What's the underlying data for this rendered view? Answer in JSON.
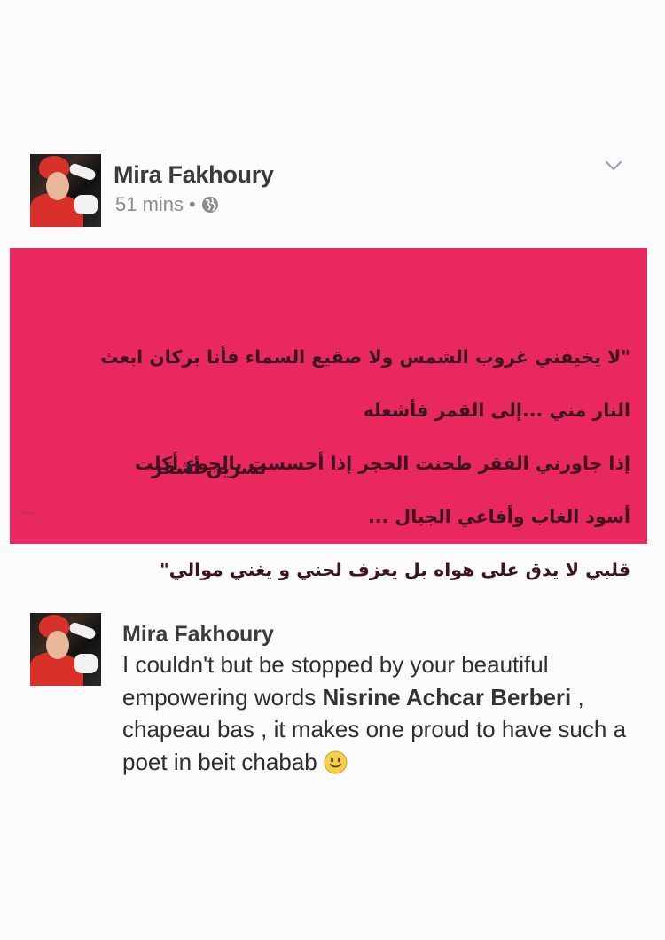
{
  "post": {
    "author": "Mira Fakhoury",
    "time": "51 mins",
    "separator": "•",
    "privacy_icon": "globe-icon",
    "menu_icon": "chevron-down-icon"
  },
  "quote_card": {
    "background": "#e8285e",
    "text_color": "#3a1420",
    "lines": [
      "\"لا يخيفني غروب الشمس ولا صقيع السماء فأنا بركان ابعث",
      "النار مني ...إلى القمر فأشعله",
      "إذا جاورني الفقر طحنت الحجر إذا أحسست بالجوع أكلت",
      "أسود الغاب وأفاعي الجبال ...",
      "قلبي لا يدق على هواه بل يعزف لحني و يغني موالي\""
    ],
    "signature": "نسرين أشقر"
  },
  "comment": {
    "author": "Mira Fakhoury",
    "text_part1": "I couldn't but be stopped by your beautiful empowering words ",
    "mention": "Nisrine Achcar Berberi",
    "text_part2": " , chapeau bas , it makes one proud to have such a poet in beit chabab ",
    "emoji_icon": "smiley-icon"
  }
}
